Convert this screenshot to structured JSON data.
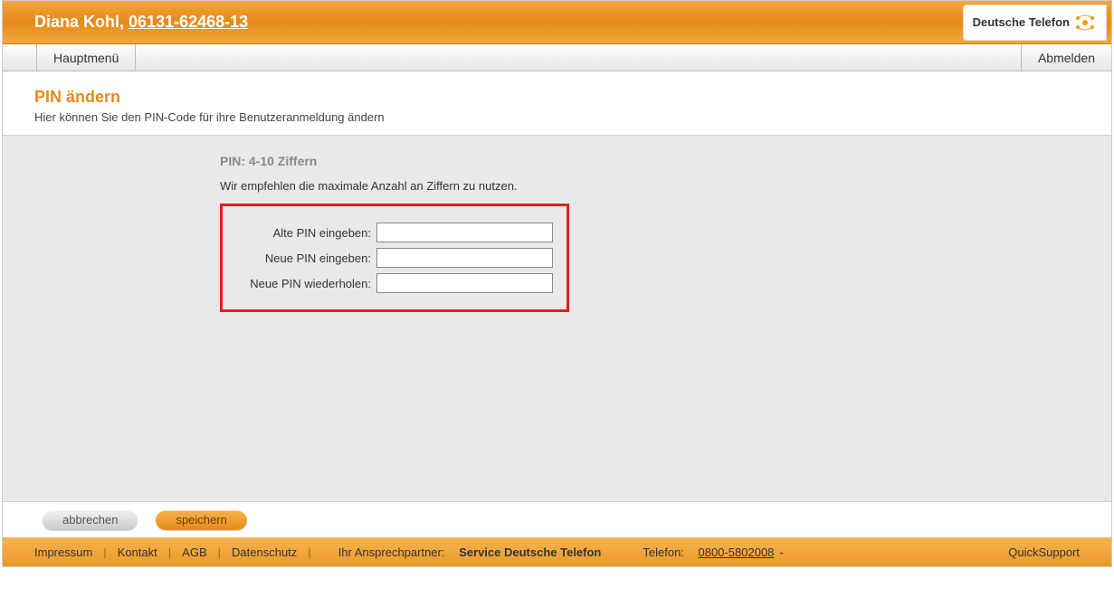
{
  "header": {
    "user_name": "Diana Kohl",
    "user_number": "06131-62468-13",
    "logo_text": "Deutsche Telefon"
  },
  "menu": {
    "main_label": "Hauptmenü",
    "logout_label": "Abmelden"
  },
  "page": {
    "title": "PIN ändern",
    "subtitle": "Hier können Sie den PIN-Code für ihre Benutzeranmeldung ändern"
  },
  "form": {
    "section_title": "PIN: 4-10 Ziffern",
    "hint": "Wir empfehlen die maximale Anzahl an Ziffern zu nutzen.",
    "old_pin_label": "Alte PIN eingeben:",
    "new_pin_label": "Neue PIN eingeben:",
    "repeat_pin_label": "Neue PIN wiederholen:",
    "old_pin_value": "",
    "new_pin_value": "",
    "repeat_pin_value": ""
  },
  "buttons": {
    "cancel": "abbrechen",
    "save": "speichern"
  },
  "footer": {
    "links": {
      "impressum": "Impressum",
      "kontakt": "Kontakt",
      "agb": "AGB",
      "datenschutz": "Datenschutz"
    },
    "contact_label": "Ihr Ansprechpartner:",
    "contact_value": "Service Deutsche Telefon",
    "phone_label": "Telefon:",
    "phone_number": "0800-5802008",
    "phone_suffix": "-",
    "quicksupport": "QuickSupport"
  }
}
